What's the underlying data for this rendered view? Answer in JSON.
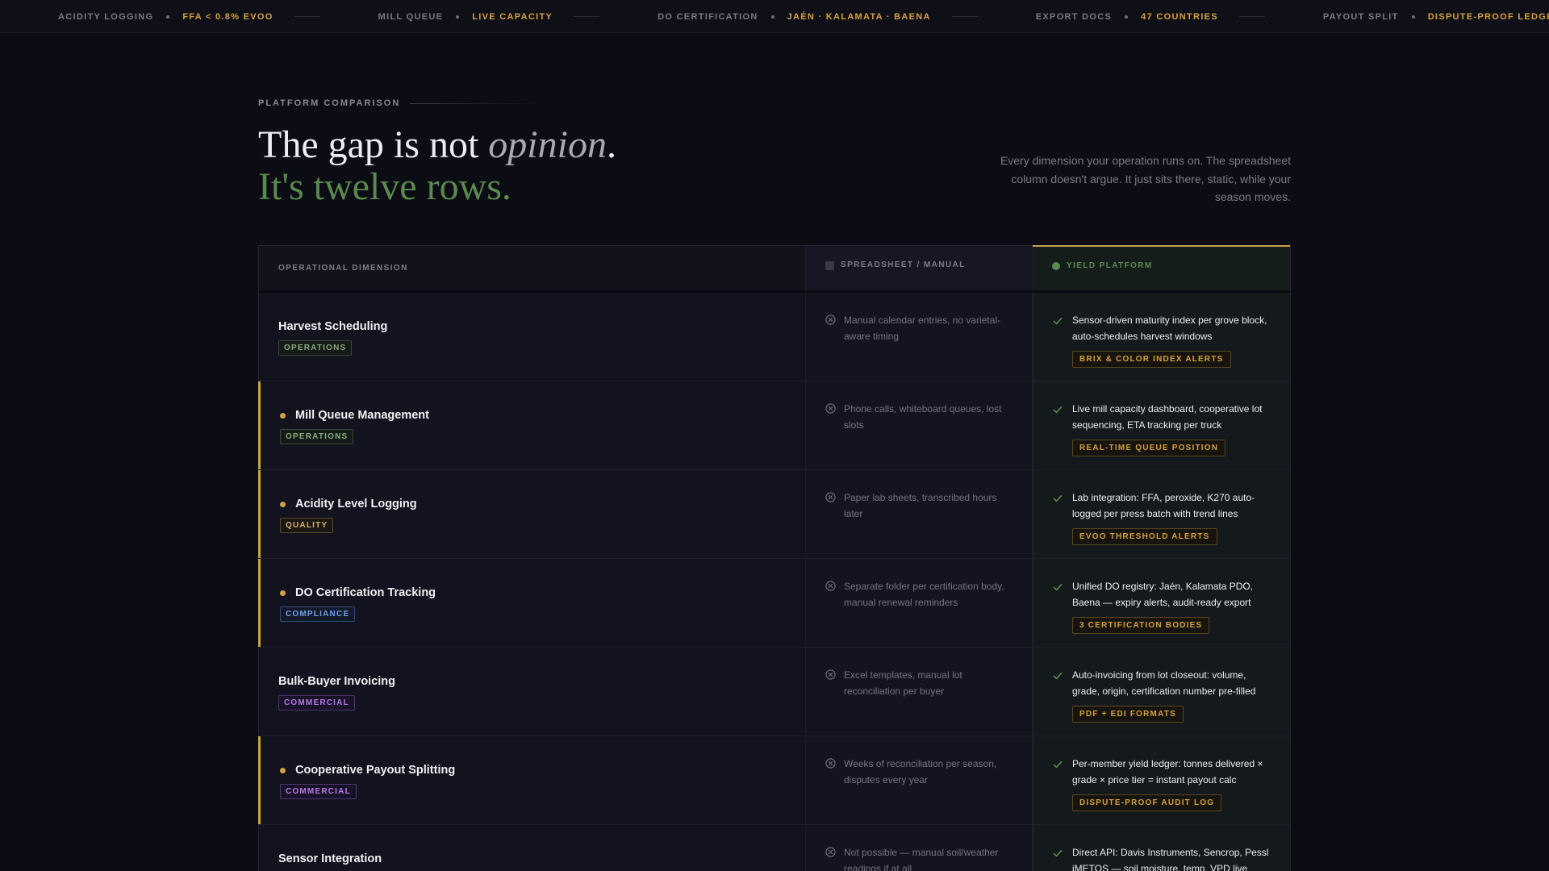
{
  "ticker": [
    {
      "label": "ACIDITY LOGGING",
      "value": "FFA < 0.8% EVOO"
    },
    {
      "label": "MILL QUEUE",
      "value": "LIVE CAPACITY"
    },
    {
      "label": "DO CERTIFICATION",
      "value": "JAÉN · KALAMATA · BAENA"
    },
    {
      "label": "EXPORT DOCS",
      "value": "47 COUNTRIES"
    },
    {
      "label": "PAYOUT SPLIT",
      "value": "DISPUTE-PROOF LEDGER"
    }
  ],
  "header": {
    "eyebrow": "PLATFORM COMPARISON",
    "headline_a": "The gap is not ",
    "headline_italic": "opinion",
    "headline_period": ".",
    "headline_b": "It's twelve rows.",
    "lede": "Every dimension your operation runs on. The spreadsheet column doesn't argue. It just sits there, static, while your season moves."
  },
  "table": {
    "col_dimension": "OPERATIONAL DIMENSION",
    "col_sheet": "SPREADSHEET / MANUAL",
    "col_yield": "YIELD PLATFORM",
    "rows": [
      {
        "title": "Harvest Scheduling",
        "tag": "OPERATIONS",
        "tag_type": "operations",
        "highlight": false,
        "sheet": "Manual calendar entries, no varietal-aware timing",
        "yield": "Sensor-driven maturity index per grove block, auto-schedules harvest windows",
        "yield_tag": "BRIX & COLOR INDEX ALERTS"
      },
      {
        "title": "Mill Queue Management",
        "tag": "OPERATIONS",
        "tag_type": "operations",
        "highlight": true,
        "sheet": "Phone calls, whiteboard queues, lost slots",
        "yield": "Live mill capacity dashboard, cooperative lot sequencing, ETA tracking per truck",
        "yield_tag": "REAL-TIME QUEUE POSITION"
      },
      {
        "title": "Acidity Level Logging",
        "tag": "QUALITY",
        "tag_type": "quality",
        "highlight": true,
        "sheet": "Paper lab sheets, transcribed hours later",
        "yield": "Lab integration: FFA, peroxide, K270 auto-logged per press batch with trend lines",
        "yield_tag": "EVOO THRESHOLD ALERTS"
      },
      {
        "title": "DO Certification Tracking",
        "tag": "COMPLIANCE",
        "tag_type": "compliance",
        "highlight": true,
        "sheet": "Separate folder per certification body, manual renewal reminders",
        "yield": "Unified DO registry: Jaén, Kalamata PDO, Baena — expiry alerts, audit-ready export",
        "yield_tag": "3 CERTIFICATION BODIES"
      },
      {
        "title": "Bulk-Buyer Invoicing",
        "tag": "COMMERCIAL",
        "tag_type": "commercial",
        "highlight": false,
        "sheet": "Excel templates, manual lot reconciliation per buyer",
        "yield": "Auto-invoicing from lot closeout: volume, grade, origin, certification number pre-filled",
        "yield_tag": "PDF + EDI FORMATS"
      },
      {
        "title": "Cooperative Payout Splitting",
        "tag": "COMMERCIAL",
        "tag_type": "commercial",
        "highlight": true,
        "sheet": "Weeks of reconciliation per season, disputes every year",
        "yield": "Per-member yield ledger: tonnes delivered × grade × price tier = instant payout calc",
        "yield_tag": "DISPUTE-PROOF AUDIT LOG"
      },
      {
        "title": "Sensor Integration",
        "tag": "",
        "tag_type": "operations",
        "highlight": false,
        "sheet": "Not possible — manual soil/weather readings if at all",
        "yield": "Direct API: Davis Instruments, Sencrop, Pessl iMETOS — soil moisture, temp, VPD live",
        "yield_tag": ""
      }
    ]
  },
  "colors": {
    "accent_gold": "#d6a23e",
    "accent_green": "#5b8a4e",
    "background": "#0c0c14"
  }
}
